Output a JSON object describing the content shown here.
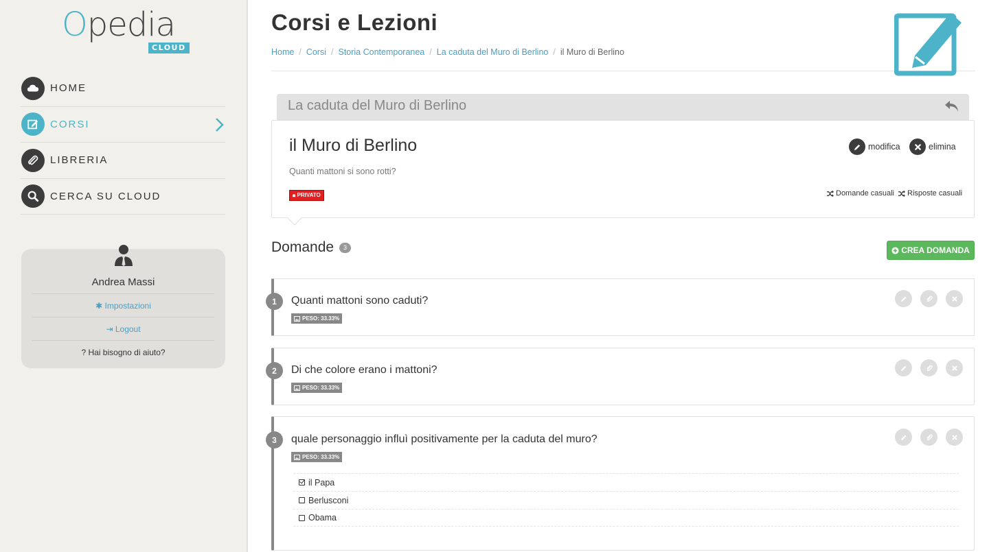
{
  "brand": {
    "logo_text": "Opedia",
    "logo_badge": "CLOUD",
    "accent": "#4cb3c9"
  },
  "sidebar": {
    "items": [
      {
        "label": "HOME",
        "icon": "cloud-icon"
      },
      {
        "label": "CORSI",
        "icon": "edit-icon",
        "active": true
      },
      {
        "label": "LIBRERIA",
        "icon": "paperclip-icon"
      },
      {
        "label": "CERCA SU CLOUD",
        "icon": "search-icon"
      }
    ]
  },
  "user": {
    "name": "Andrea Massi",
    "settings_label": "Impostazioni",
    "logout_label": "Logout",
    "help_label": "Hai bisogno di aiuto?"
  },
  "header": {
    "title": "Corsi e Lezioni",
    "breadcrumb": [
      "Home",
      "Corsi",
      "Storia Contemporanea",
      "La caduta del Muro di Berlino",
      "il Muro di Berlino"
    ]
  },
  "lesson": {
    "parent_title": "La caduta del Muro di Berlino",
    "title": "il Muro di Berlino",
    "description": "Quanti mattoni si sono rotti?",
    "privacy_badge": "PRIVATO",
    "edit_label": "modifica",
    "delete_label": "elimina",
    "random_questions_label": "Domande casuali",
    "random_answers_label": "Risposte casuali"
  },
  "questions_section": {
    "title": "Domande",
    "count": "3",
    "create_label": "CREA DOMANDA",
    "create_color": "#5cb85c"
  },
  "questions": [
    {
      "number": "1",
      "text": "Quanti mattoni sono caduti?",
      "weight": "PESO: 33.33%"
    },
    {
      "number": "2",
      "text": "Di che colore erano i mattoni?",
      "weight": "PESO: 33.33%"
    },
    {
      "number": "3",
      "text": "quale personaggio influì positivamente per la caduta del muro?",
      "weight": "PESO: 33.33%",
      "answers": [
        {
          "text": "il Papa",
          "correct": true
        },
        {
          "text": "Berlusconi",
          "correct": false
        },
        {
          "text": "Obama",
          "correct": false
        }
      ]
    }
  ]
}
